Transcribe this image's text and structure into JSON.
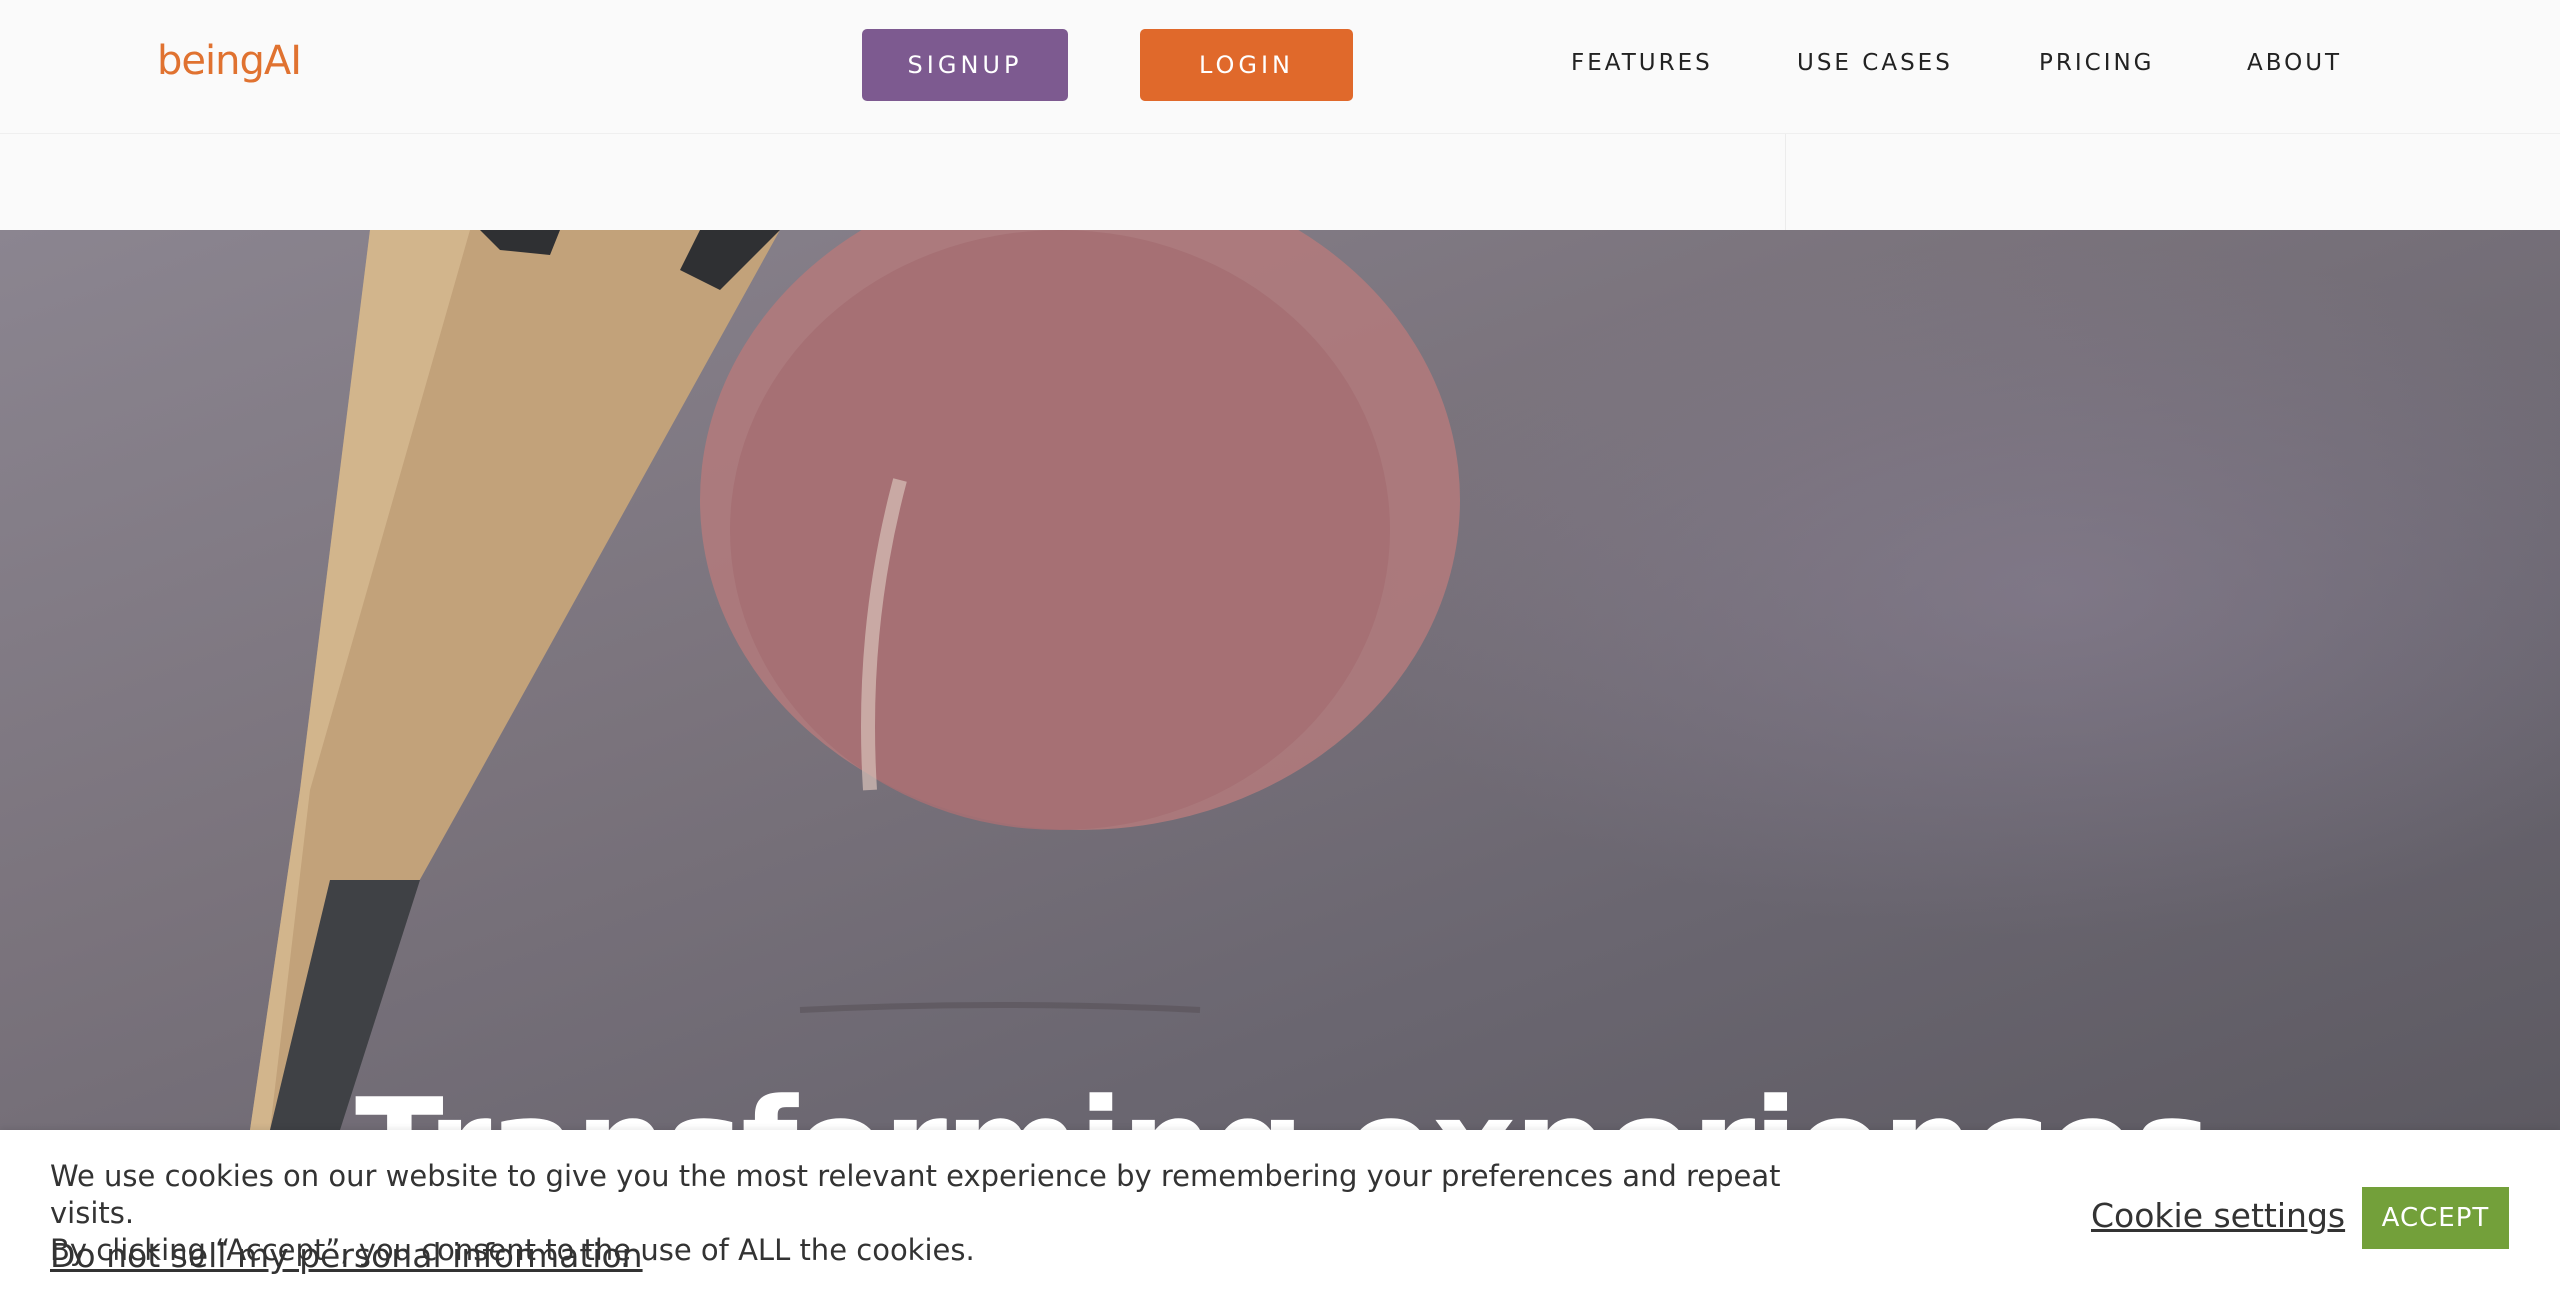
{
  "header": {
    "logo": "beingAI",
    "signup_label": "SIGNUP",
    "login_label": "LOGIN",
    "nav": [
      "FEATURES",
      "USE CASES",
      "PRICING",
      "ABOUT"
    ]
  },
  "hero": {
    "heading": "Transforming experiences"
  },
  "cookie_banner": {
    "text_line1": "We use cookies on our website to give you the most relevant experience by remembering your preferences and repeat visits.",
    "text_line2": "By clicking “Accept”, you consent to the use of ALL the cookies.",
    "do_not_sell_link": "Do not sell my personal information",
    "period": ".",
    "settings_link": "Cookie settings",
    "accept_label": "ACCEPT"
  },
  "colors": {
    "brand_orange": "#e0692b",
    "signup_purple": "#7d5a90",
    "accept_green": "#73a03a"
  }
}
